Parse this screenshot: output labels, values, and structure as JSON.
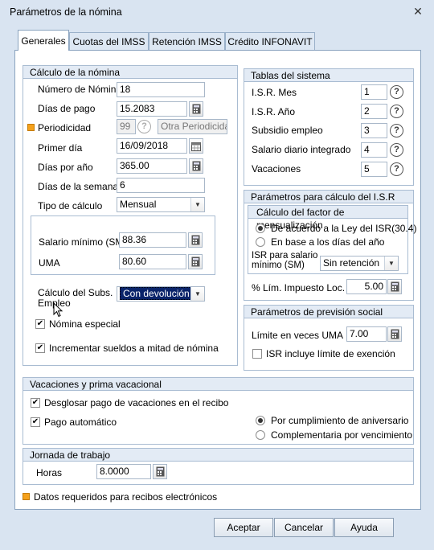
{
  "window": {
    "title": "Parámetros de la nómina"
  },
  "tabs": [
    "Generales",
    "Cuotas del IMSS",
    "Retención IMSS",
    "Crédito INFONAVIT"
  ],
  "calculo": {
    "title": "Cálculo de la nómina",
    "numero_label": "Número de Nómina",
    "numero_value": "18",
    "dias_pago_label": "Días de pago",
    "dias_pago_value": "15.2083",
    "periodicidad_label": "Periodicidad",
    "periodicidad_value": "99",
    "periodicidad_text": "Otra Periodicidad",
    "primer_dia_label": "Primer día",
    "primer_dia_value": "16/09/2018",
    "dias_anio_label": "Días por año",
    "dias_anio_value": "365.00",
    "dia_semana_label": "Días de la semana",
    "dia_semana_value": "6",
    "tipo_label": "Tipo de cálculo",
    "tipo_value": "Mensual",
    "salario_label": "Salario mínimo (SM)",
    "salario_value": "88.36",
    "uma_label": "UMA",
    "uma_value": "80.60",
    "subs_label_1": "Cálculo del Subs.",
    "subs_label_2": "Empleo",
    "subs_value": "Con devolución",
    "nomina_especial_label": "Nómina especial",
    "incrementar_label": "Incrementar sueldos a mitad de nómina"
  },
  "tablas": {
    "title": "Tablas del sistema",
    "rows": [
      {
        "label": "I.S.R. Mes",
        "value": "1"
      },
      {
        "label": "I.S.R. Año",
        "value": "2"
      },
      {
        "label": "Subsidio empleo",
        "value": "3"
      },
      {
        "label": "Salario diario integrado",
        "value": "4"
      },
      {
        "label": "Vacaciones",
        "value": "5"
      }
    ]
  },
  "isr": {
    "title": "Parámetros para cálculo del I.S.R",
    "factor_title": "Cálculo del factor de mensualización",
    "opt1": "De acuerdo a la Ley del ISR(30.4)",
    "opt2": "En base a los días del año",
    "salario_label_1": "ISR para salario",
    "salario_label_2": "mínimo (SM)",
    "salario_value": "Sin retención",
    "lim_label": "% Lím. Impuesto Loc.",
    "lim_value": "5.00"
  },
  "prevision": {
    "title": "Parámetros de previsión social",
    "limite_label": "Límite en veces UMA",
    "limite_value": "7.00",
    "isr_incluye_label": "ISR incluye límite de exención"
  },
  "vacaciones": {
    "title": "Vacaciones y prima vacacional",
    "desglosar_label": "Desglosar pago de vacaciones en el recibo",
    "pago_auto_label": "Pago automático",
    "opt_aniversario": "Por cumplimiento de aniversario",
    "opt_complementaria": "Complementaria por vencimiento"
  },
  "jornada": {
    "title": "Jornada de trabajo",
    "horas_label": "Horas",
    "horas_value": "8.0000"
  },
  "legend": "Datos requeridos para recibos electrónicos",
  "buttons": {
    "aceptar": "Aceptar",
    "cancelar": "Cancelar",
    "ayuda": "Ayuda"
  },
  "colors": {
    "accent": "#f5a11c",
    "window": "#d9e4f1",
    "selection": "#0a246a"
  }
}
